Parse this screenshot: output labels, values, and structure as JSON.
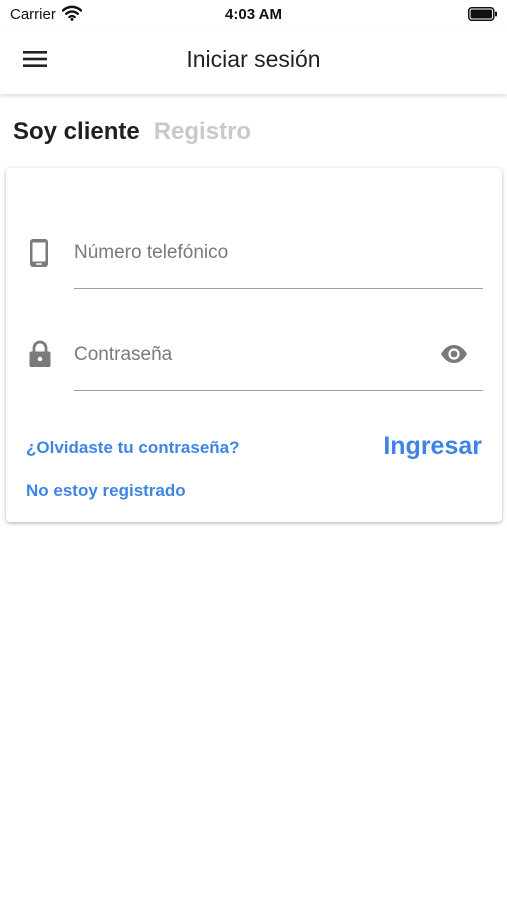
{
  "status_bar": {
    "carrier": "Carrier",
    "time": "4:03 AM"
  },
  "app_bar": {
    "title": "Iniciar sesión",
    "menu_icon": "hamburger-menu-icon"
  },
  "tabs": [
    {
      "label": "Soy cliente",
      "active": true
    },
    {
      "label": "Registro",
      "active": false
    }
  ],
  "login_form": {
    "phone": {
      "placeholder": "Número telefónico",
      "icon": "phone-icon"
    },
    "password": {
      "placeholder": "Contraseña",
      "icon": "lock-icon",
      "toggle_icon": "eye-icon"
    },
    "forgot_password": "¿Olvidaste tu contraseña?",
    "submit_label": "Ingresar",
    "not_registered": "No estoy registrado"
  },
  "colors": {
    "accent": "#3f84e5",
    "tab_inactive": "#c9c9c9",
    "icon_gray": "#7a7a7a"
  }
}
